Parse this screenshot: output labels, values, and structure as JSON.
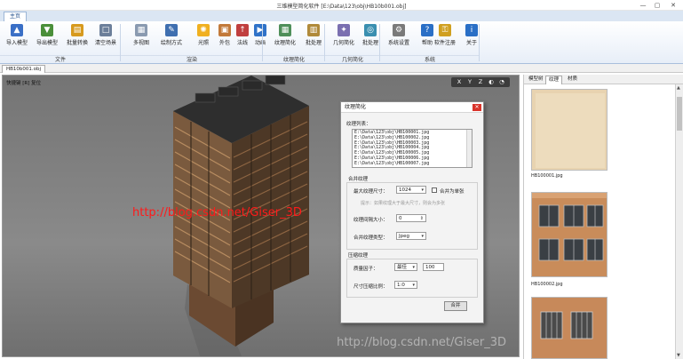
{
  "window": {
    "title": "三维模型简化软件  [E:\\Data\\123\\obj\\HB10b001.obj]",
    "controls": [
      "—",
      "▢",
      "✕"
    ]
  },
  "ribbon": {
    "tab": "主页",
    "buttons": [
      {
        "label": "导入模型",
        "icon": "import-model-icon",
        "color": "#3a6fc6",
        "glyph": "▲"
      },
      {
        "label": "导出模型",
        "icon": "export-model-icon",
        "color": "#4a8f3a",
        "glyph": "▼"
      },
      {
        "label": "批量转换",
        "icon": "batch-convert-icon",
        "color": "#d79a1e",
        "glyph": "▤"
      },
      {
        "label": "清空场景",
        "icon": "clear-scene-icon",
        "color": "#6c7f9a",
        "glyph": "□"
      },
      {
        "label": "多视图",
        "icon": "multi-view-icon",
        "color": "#8a9ab0",
        "glyph": "▦"
      },
      {
        "label": "绘制方式",
        "icon": "draw-mode-icon",
        "color": "#3f6fb0",
        "glyph": "✎"
      },
      {
        "label": "光照",
        "icon": "lighting-icon",
        "color": "#f0b020",
        "glyph": "✺"
      },
      {
        "label": "外包",
        "icon": "bounding-box-icon",
        "color": "#c27a3a",
        "glyph": "▣"
      },
      {
        "label": "法线",
        "icon": "normal-icon",
        "color": "#c03f3f",
        "glyph": "↑"
      },
      {
        "label": "动画",
        "icon": "animation-icon",
        "color": "#2f72c8",
        "glyph": "▶"
      },
      {
        "label": "纹理简化",
        "icon": "texture-simplify-icon",
        "color": "#4f8f5a",
        "glyph": "▦"
      },
      {
        "label": "批处理",
        "icon": "batch-texture-icon",
        "color": "#b08a3a",
        "glyph": "▥"
      },
      {
        "label": "几何简化",
        "icon": "geometry-simplify-icon",
        "color": "#7a6fb0",
        "glyph": "✦"
      },
      {
        "label": "批处理",
        "icon": "batch-geometry-icon",
        "color": "#3a8fb0",
        "glyph": "◎"
      },
      {
        "label": "系统设置",
        "icon": "settings-icon",
        "color": "#7a7a7a",
        "glyph": "⚙"
      },
      {
        "label": "帮助",
        "icon": "help-icon",
        "color": "#2a6fc6",
        "glyph": "?"
      },
      {
        "label": "软件注册",
        "icon": "register-icon",
        "color": "#d0a020",
        "glyph": "⚿"
      },
      {
        "label": "关于",
        "icon": "about-icon",
        "color": "#2a6fc6",
        "glyph": "i"
      }
    ],
    "groups": [
      "文件",
      "渲染",
      "纹理简化",
      "几何简化",
      "系统"
    ]
  },
  "document": {
    "tab": "HB10b001.obj"
  },
  "viewport": {
    "shortcut_hint": "快捷键 [R] 复位",
    "nav": [
      "X",
      "Y",
      "Z",
      "◐",
      "◔"
    ],
    "watermark": "http://blog.csdn.net/Giser_3D",
    "watermark_bottom": "http://blog.csdn.net/Giser_3D"
  },
  "dialog": {
    "title": "纹理简化",
    "close": "✕",
    "list_label": "纹理列表：",
    "textures": [
      "E:\\Data\\123\\obj\\HB100001.jpg",
      "E:\\Data\\123\\obj\\HB100002.jpg",
      "E:\\Data\\123\\obj\\HB100003.jpg",
      "E:\\Data\\123\\obj\\HB100004.jpg",
      "E:\\Data\\123\\obj\\HB100005.jpg",
      "E:\\Data\\123\\obj\\HB100006.jpg",
      "E:\\Data\\123\\obj\\HB100007.jpg"
    ],
    "merge_section": "合并纹理",
    "max_size_label": "最大纹理尺寸：",
    "max_size_value": "1024",
    "merge_single_label": "合并为单张",
    "hint": "提示：如果纹理大于最大尺寸，则会为多张",
    "gap_label": "纹理间隔大小：",
    "gap_value": "0",
    "merge_type_label": "合并纹理类型：",
    "merge_type_value": "Jpeg",
    "compress_section": "压缩纹理",
    "quality_label": "质量因子：",
    "quality_value": "最佳",
    "quality_number": "100",
    "ratio_label": "尺寸压缩比例：",
    "ratio_value": "1:0",
    "merge_button": "合并"
  },
  "panel": {
    "tabs": [
      "模型树",
      "纹理",
      "材质"
    ],
    "active_tab": "纹理",
    "thumbnails": [
      {
        "caption": "HB100001.jpg"
      },
      {
        "caption": "HB100002.jpg"
      },
      {
        "caption": ""
      }
    ]
  }
}
